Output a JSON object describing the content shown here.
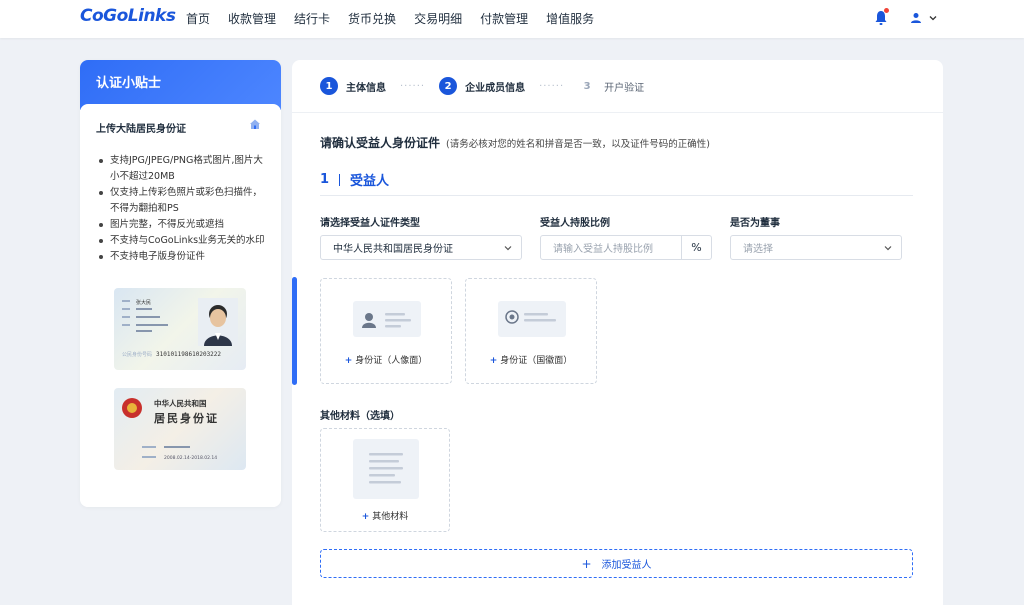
{
  "app": {
    "logo": "CoGoLinks"
  },
  "nav": {
    "items": [
      "首页",
      "收款管理",
      "结行卡",
      "货币兑换",
      "交易明细",
      "付款管理",
      "增值服务"
    ]
  },
  "tips": {
    "title": "认证小贴士",
    "subtitle": "上传大陆居民身份证",
    "items": [
      "支持JPG/JPEG/PNG格式图片,图片大小不超过20MB",
      "仅支持上传彩色照片或彩色扫描件，不得为翻拍和PS",
      "图片完整，不得反光或遮挡",
      "不支持与CoGoLinks业务无关的水印",
      "不支持电子版身份证件"
    ],
    "card_front": {
      "name": "张大民",
      "number": "310101198610203222"
    },
    "card_back": {
      "line1": "中华人民共和国",
      "line2": "居民身份证",
      "date": "2008.02.14-2018.02.14"
    }
  },
  "steps": [
    {
      "num": "1",
      "label": "主体信息",
      "active": true
    },
    {
      "num": "2",
      "label": "企业成员信息",
      "active": true
    },
    {
      "num": "3",
      "label": "开户验证",
      "active": false
    }
  ],
  "form": {
    "heading": "请确认受益人身份证件",
    "heading_note": "(请务必核对您的姓名和拼音是否一致，以及证件号码的正确性)",
    "beneficiary_index": "1",
    "beneficiary_label": "受益人",
    "id_type_label": "请选择受益人证件类型",
    "id_type_value": "中华人民共和国居民身份证",
    "share_label": "受益人持股比例",
    "share_placeholder": "请输入受益人持股比例",
    "share_unit": "%",
    "director_label": "是否为董事",
    "director_placeholder": "请选择",
    "upload_front": "身份证（人像面）",
    "upload_back": "身份证（国徽面）",
    "other_title": "其他材料（选填）",
    "upload_other": "其他材料",
    "add_beneficiary": "添加受益人"
  },
  "colors": {
    "primary": "#1a56db",
    "accent": "#2f6df6",
    "badge": "#f04438"
  }
}
